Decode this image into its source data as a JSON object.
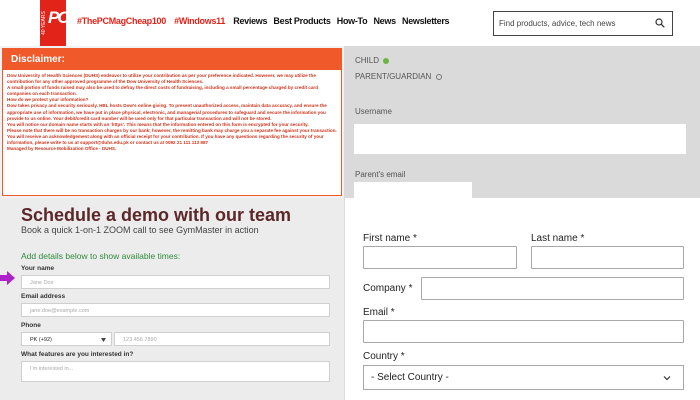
{
  "header": {
    "logo_years": "40 YEARS",
    "logo_text": "PC",
    "nav_tags": [
      "#ThePCMagCheap100",
      "#Windows11"
    ],
    "nav_links": [
      "Reviews",
      "Best Products",
      "How-To",
      "News",
      "Newsletters"
    ],
    "search_placeholder": "Find products, advice, tech news"
  },
  "disclaimer": {
    "title": "Disclaimer:",
    "paragraphs": [
      "Dow University of Health Sciences (DUHS) endeavor to utilize your contribution as per your preference indicated. However, we may utilize the contribution for any other approved programme of the Dow University of Health Sciences.",
      "A small portion of funds raised may also be used to defray the direct costs of fundraising, including a small percentage charged by credit card companies on each transaction.",
      "How do we protect your information?",
      "Dow takes privacy and security seriously. HBL hosts Dow's online giving. To present unauthorized access, maintain data accuracy, and ensure the appropriate use of information, we have put in place physical, electronic, and managerial procedures to safeguard and secure the information you provide to us online. Your debit/credit card number will be used only for that particular transaction and will not be stored.",
      "You will notice our domain name starts with an 'https'. This means that the information entered on this form is encrypted for your security.",
      "Please note that there will be no transaction charges by our bank; however, the remitting bank may charge you a separate fee against your transaction. You will receive an acknowledgement along with an official receipt for your contribution. If you have any questions regarding the security of your information, please write to us at support@duhs.edu.pk or contact us at 0092 21 111 113 887",
      "Managed by Resource Mobilization Office - DUHS."
    ]
  },
  "registration": {
    "child_label": "CHILD",
    "parent_label": "PARENT/GUARDIAN",
    "username_label": "Username",
    "parent_email_label": "Parent's email"
  },
  "demo": {
    "title": "Schedule a demo with our team",
    "subtitle": "Book a quick 1-on-1 ZOOM call to see GymMaster in action",
    "hint": "Add details below to show available times:",
    "name_label": "Your name",
    "name_placeholder": "Jane Doe",
    "email_label": "Email address",
    "email_placeholder": "jane.doe@example.com",
    "phone_label": "Phone",
    "phone_country": "PK (+92)",
    "phone_placeholder": "123 456 7890",
    "features_label": "What features are you interested in?",
    "features_placeholder": "I'm interested in..."
  },
  "contact_form": {
    "first_name_label": "First name *",
    "last_name_label": "Last name *",
    "company_label": "Company *",
    "email_label": "Email *",
    "country_label": "Country *",
    "country_value": "- Select Country -"
  },
  "colors": {
    "brand_red": "#e2231a",
    "disclaimer_orange": "#f05a2a",
    "demo_title": "#5c2728",
    "hint_green": "#2e8b3c",
    "arrow_purple": "#b022c9"
  },
  "icons": [
    "search-icon",
    "radio-checked-icon",
    "radio-unchecked-icon",
    "arrow-pointer-icon",
    "chevron-down-icon",
    "select-arrow-icon"
  ]
}
